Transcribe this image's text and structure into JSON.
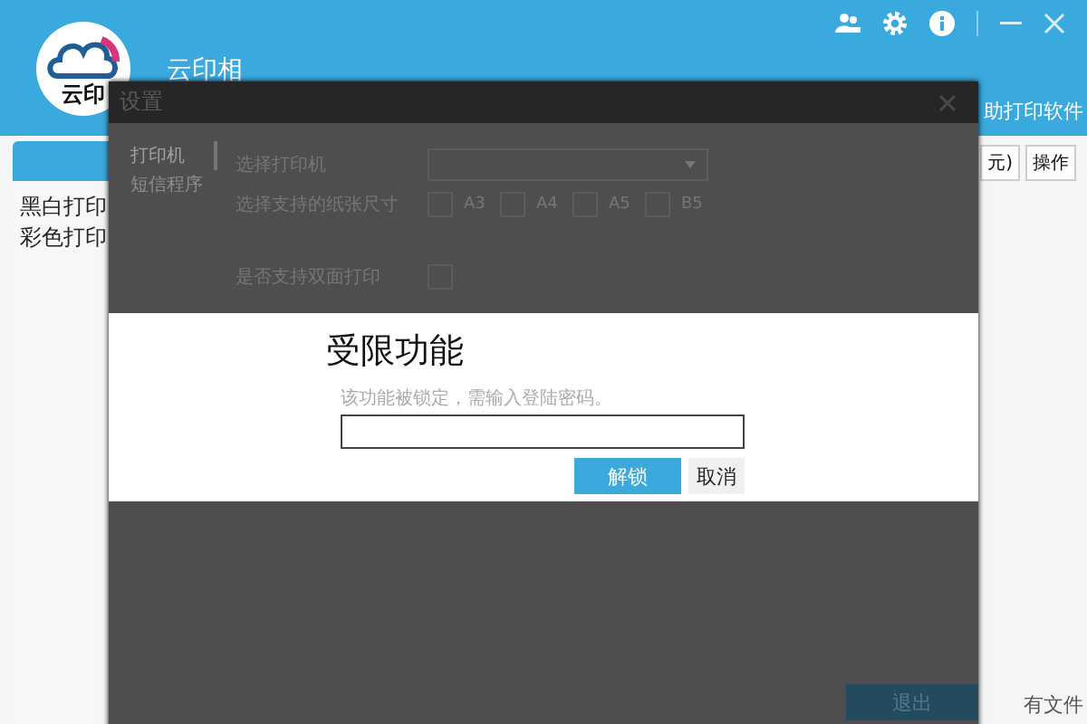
{
  "app": {
    "logo_text": "云印",
    "title": "云印相",
    "subtitle": "助打印软件",
    "sidebar": {
      "items": [
        "黑白打印",
        "彩色打印"
      ]
    },
    "header_buttons": [
      "元)",
      "操作"
    ],
    "footer_text": "有文件"
  },
  "settings": {
    "title": "设置",
    "nav": [
      {
        "label": "打印机",
        "selected": true
      },
      {
        "label": "短信程序",
        "selected": false
      }
    ],
    "printer_label": "选择打印机",
    "paper_label": "选择支持的纸张尺寸",
    "paper_sizes": [
      {
        "label": "A3",
        "checked": false
      },
      {
        "label": "A4",
        "checked": false
      },
      {
        "label": "A5",
        "checked": false
      },
      {
        "label": "B5",
        "checked": false
      }
    ],
    "options": [
      {
        "label": "是否支持双面打印",
        "checked": false
      }
    ],
    "exit_button": "退出"
  },
  "modal": {
    "title": "受限功能",
    "message": "该功能被锁定，需输入登陆密码。",
    "buttons": [
      {
        "label": "解锁",
        "kind": "primary"
      },
      {
        "label": "取消",
        "kind": "secondary"
      }
    ]
  }
}
